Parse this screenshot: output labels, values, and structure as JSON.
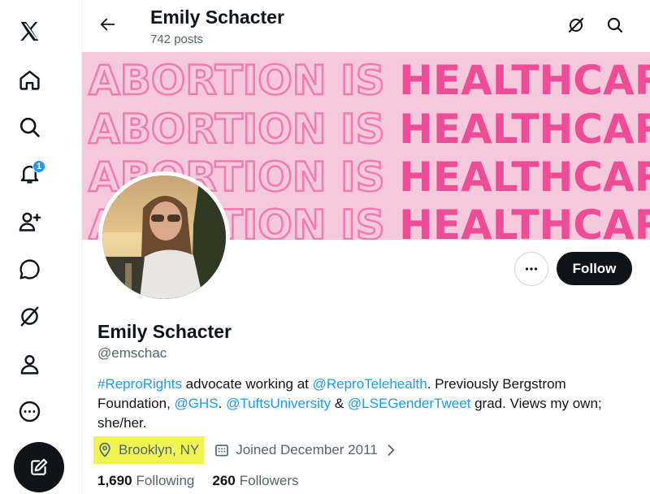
{
  "header": {
    "name": "Emily Schacter",
    "posts": "742 posts"
  },
  "nav": {
    "notifications_badge": "1",
    "items": [
      "x-logo",
      "home",
      "explore",
      "notifications",
      "follow",
      "messages",
      "grok",
      "profile",
      "more",
      "post"
    ]
  },
  "banner": {
    "outline_text": "ABORTION IS",
    "fill_text": "HEALTHCARE",
    "background": "#f6c8dc",
    "accent": "#ee4c97"
  },
  "actions": {
    "follow_label": "Follow"
  },
  "profile": {
    "name": "Emily Schacter",
    "handle": "@emschac",
    "bio": {
      "hashtag": "#ReproRights",
      "t1": " advocate working at ",
      "mention1": "@ReproTelehealth",
      "t2": ". Previously Bergstrom Foundation, ",
      "mention2": "@GHS",
      "t3": ". ",
      "mention3": "@TuftsUniversity",
      "t4": " & ",
      "mention4": "@LSEGenderTweet",
      "t5": " grad. Views my own; she/her."
    },
    "location": "Brooklyn, NY",
    "joined": "Joined December 2011",
    "following_count": "1,690",
    "following_label": "Following",
    "followers_count": "260",
    "followers_label": "Followers"
  },
  "colors": {
    "link": "#1d9bf0",
    "highlight": "#eef553",
    "text": "#0f1419",
    "secondary": "#536471"
  }
}
